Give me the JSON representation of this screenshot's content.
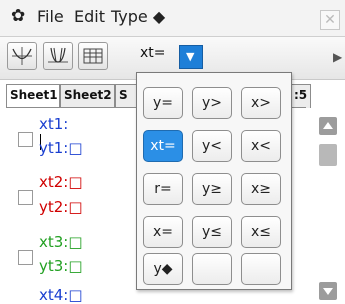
{
  "menubar": {
    "gear_icon": "✿",
    "file": "File",
    "edit": "Edit",
    "type": "Type ◆",
    "close": "✕"
  },
  "toolbar": {
    "type_selector": "xt=",
    "dropdown_arrow": "▼",
    "scroll_right": "▶"
  },
  "sheets": {
    "tabs": [
      "Sheet1",
      "Sheet2",
      "S",
      ":5"
    ]
  },
  "equations": [
    {
      "x": "xt1:",
      "y": "yt1:□",
      "color": "#1a3fd0"
    },
    {
      "x": "xt2:□",
      "y": "yt2:□",
      "color": "#d00000"
    },
    {
      "x": "xt3:□",
      "y": "yt3:□",
      "color": "#22a022"
    },
    {
      "x": "xt4:□",
      "color": "#1a3fd0"
    }
  ],
  "palette": {
    "buttons": [
      "y=",
      "y>",
      "x>",
      "xt=",
      "y<",
      "x<",
      "r=",
      "y≥",
      "x≥",
      "x=",
      "y≤",
      "x≤",
      "y◆",
      "",
      ""
    ],
    "selected": "xt="
  },
  "colors": {
    "accent": "#1e7fd8",
    "selected_button": "#2b8fe6"
  }
}
